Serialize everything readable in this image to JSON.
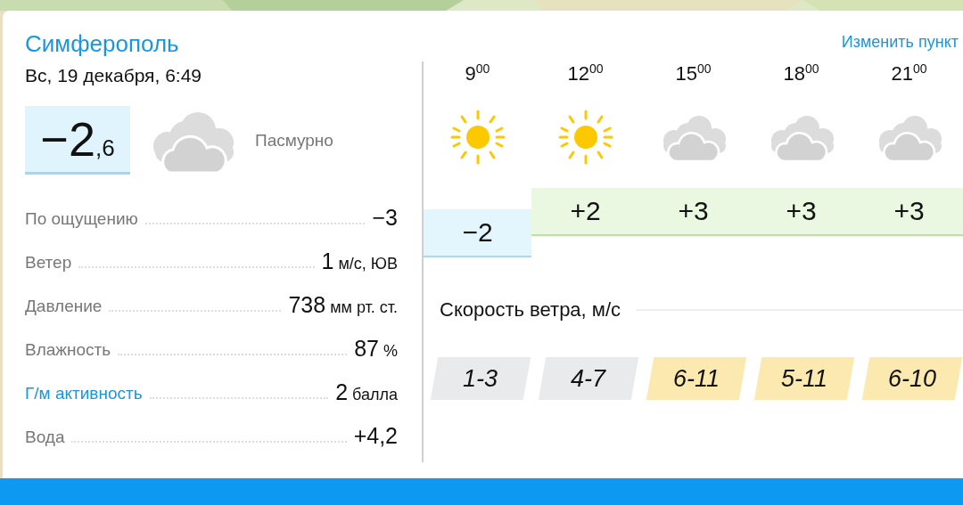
{
  "city": "Симферополь",
  "change_location": "Изменить пункт",
  "date": "Вс, 19 декабря, 6:49",
  "current": {
    "temp_whole": "−2",
    "temp_fraction": ",6",
    "condition": "Пасмурно",
    "kind": "cloud"
  },
  "details": [
    {
      "label": "По ощущению",
      "value": "−3",
      "link": false
    },
    {
      "label": "Ветер",
      "value": "1",
      "unit": "м/с, ЮВ",
      "link": false
    },
    {
      "label": "Давление",
      "value": "738",
      "unit": "мм рт. ст.",
      "link": false
    },
    {
      "label": "Влажность",
      "value": "87",
      "unit": "%",
      "link": false
    },
    {
      "label": "Г/м активность",
      "value": "2",
      "unit": "балла",
      "link": true
    },
    {
      "label": "Вода",
      "value": "+4,2",
      "link": false
    }
  ],
  "hours": [
    {
      "hour": "9",
      "minutes": "00",
      "kind": "sun",
      "temp": "−2",
      "cold": true
    },
    {
      "hour": "12",
      "minutes": "00",
      "kind": "sun",
      "temp": "+2",
      "cold": false
    },
    {
      "hour": "15",
      "minutes": "00",
      "kind": "cloud",
      "temp": "+3",
      "cold": false
    },
    {
      "hour": "18",
      "minutes": "00",
      "kind": "cloud",
      "temp": "+3",
      "cold": false
    },
    {
      "hour": "21",
      "minutes": "00",
      "kind": "cloud",
      "temp": "+3",
      "cold": false
    }
  ],
  "wind_title": "Скорость ветра, м/с",
  "wind": [
    {
      "range": "1-3",
      "color": "#e9eaec"
    },
    {
      "range": "4-7",
      "color": "#e9eaec"
    },
    {
      "range": "6-11",
      "color": "#fce9b0"
    },
    {
      "range": "5-11",
      "color": "#fce9b0"
    },
    {
      "range": "6-10",
      "color": "#fce9b0"
    }
  ]
}
